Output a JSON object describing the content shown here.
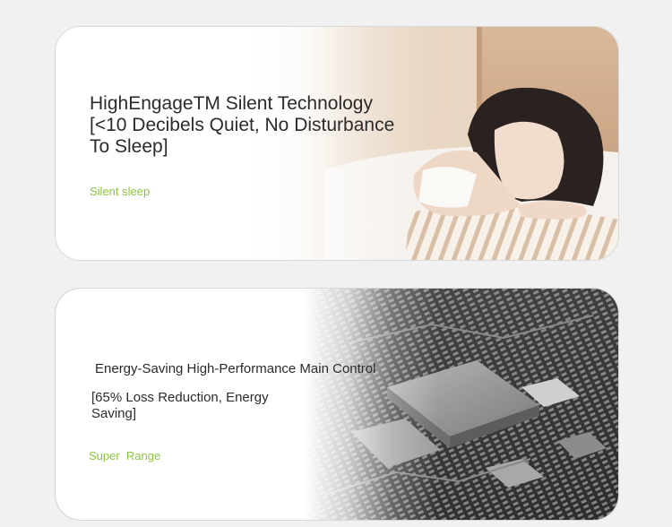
{
  "cards": [
    {
      "title_lines": [
        "HighEngageTM Silent Technology",
        "[<10 Decibels Quiet, No Disturbance",
        "To Sleep]"
      ],
      "subtitle": "Silent sleep"
    },
    {
      "title": "Energy-Saving High-Performance Main Control",
      "description": "[65% Loss Reduction, Energy Saving]",
      "subtitle": "Super  Range"
    }
  ],
  "colors": {
    "accent": "#8cc63f",
    "text": "#2b2b2b",
    "background": "#f1f1f1"
  },
  "images": [
    "sleeping-woman-photo",
    "circuit-board-photo"
  ]
}
